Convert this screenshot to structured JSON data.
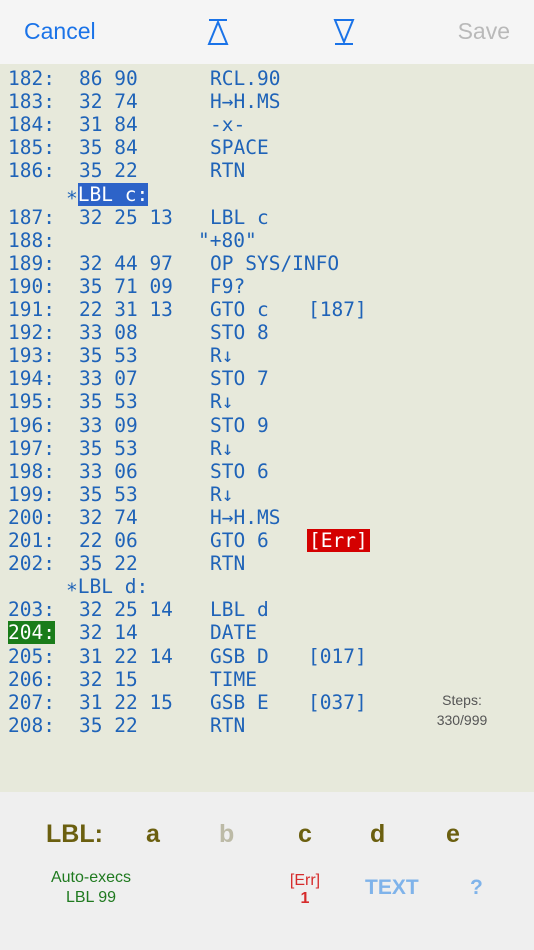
{
  "toolbar": {
    "cancel_label": "Cancel",
    "save_label": "Save"
  },
  "listing": {
    "rows": [
      {
        "num": "182:",
        "code": "86 90",
        "instr": "RCL.90"
      },
      {
        "num": "183:",
        "code": "32 74",
        "instr": "H→H.MS"
      },
      {
        "num": "184:",
        "code": "31 84",
        "instr": "-x-"
      },
      {
        "num": "185:",
        "code": "35 84",
        "instr": "SPACE"
      },
      {
        "num": "186:",
        "code": "35 22",
        "instr": "RTN"
      },
      {
        "label": "∗LBL c:"
      },
      {
        "num": "187:",
        "code": "32 25 13",
        "instr": "LBL c"
      },
      {
        "num": "188:",
        "code": "",
        "quote": "\"+80\""
      },
      {
        "num": "189:",
        "code": "32 44 97",
        "instr": "OP SYS/INFO"
      },
      {
        "num": "190:",
        "code": "35 71 09",
        "instr": "F9?"
      },
      {
        "num": "191:",
        "code": "22 31 13",
        "instr": "GTO c",
        "target": "[187]"
      },
      {
        "num": "192:",
        "code": "33 08",
        "instr": "STO 8"
      },
      {
        "num": "193:",
        "code": "35 53",
        "instr": "R↓"
      },
      {
        "num": "194:",
        "code": "33 07",
        "instr": "STO 7"
      },
      {
        "num": "195:",
        "code": "35 53",
        "instr": "R↓"
      },
      {
        "num": "196:",
        "code": "33 09",
        "instr": "STO 9"
      },
      {
        "num": "197:",
        "code": "35 53",
        "instr": "R↓"
      },
      {
        "num": "198:",
        "code": "33 06",
        "instr": "STO 6"
      },
      {
        "num": "199:",
        "code": "35 53",
        "instr": "R↓"
      },
      {
        "num": "200:",
        "code": "32 74",
        "instr": "H→H.MS"
      },
      {
        "num": "201:",
        "code": "22 06",
        "instr": "GTO 6",
        "error": "[Err]"
      },
      {
        "num": "202:",
        "code": "35 22",
        "instr": "RTN"
      },
      {
        "label": "∗LBL d:"
      },
      {
        "num": "203:",
        "code": "32 25 14",
        "instr": "LBL d"
      },
      {
        "num": "204:",
        "code": "32 14",
        "instr": "DATE",
        "current": true
      },
      {
        "num": "205:",
        "code": "31 22 14",
        "instr": "GSB D",
        "target": "[017]"
      },
      {
        "num": "206:",
        "code": "32 15",
        "instr": "TIME"
      },
      {
        "num": "207:",
        "code": "31 22 15",
        "instr": "GSB E",
        "target": "[037]"
      },
      {
        "num": "208:",
        "code": "35 22",
        "instr": "RTN"
      }
    ],
    "steps_label": "Steps:",
    "steps_value": "330/999"
  },
  "labels_bar": {
    "title": "LBL:",
    "keys": [
      "a",
      "b",
      "c",
      "d",
      "e"
    ],
    "autoexec_line1": "Auto-execs",
    "autoexec_line2": "LBL 99",
    "err_label": "[Err]",
    "err_count": "1",
    "text_button": "TEXT",
    "help_button": "?"
  },
  "colors": {
    "accent": "#1a73e8",
    "listing_bg": "#e7e9db",
    "code_text": "#1f63b8",
    "error_bg": "#d40000",
    "current_bg": "#1a7c1a",
    "label_highlight": "#2d63c8",
    "lbl_keys": "#6b5f0f"
  },
  "icons": {
    "top_button": "jump-to-top-icon",
    "bottom_button": "jump-to-bottom-icon"
  }
}
